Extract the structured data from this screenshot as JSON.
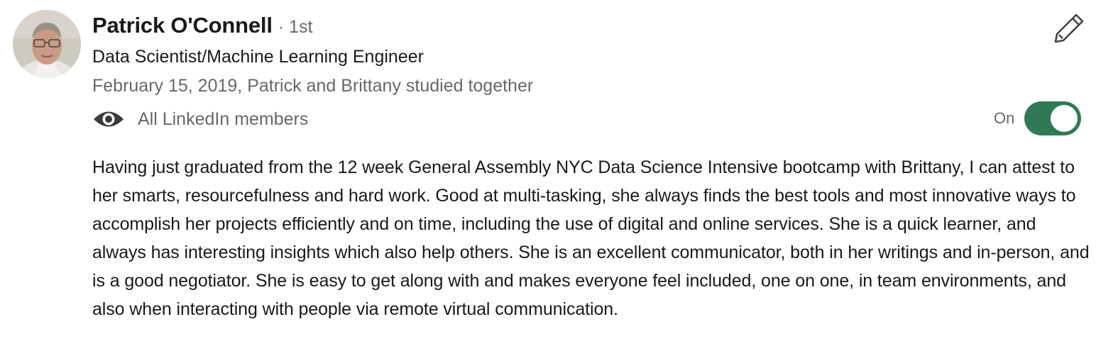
{
  "recommendation": {
    "author": {
      "name": "Patrick O'Connell",
      "degree": "· 1st",
      "headline": "Data Scientist/Machine Learning Engineer"
    },
    "relationship": "February 15, 2019, Patrick and Brittany studied together",
    "visibility": {
      "icon": "eye-icon",
      "label": "All LinkedIn members"
    },
    "toggle": {
      "label": "On",
      "state": "on",
      "color": "#2f7a54"
    },
    "edit_icon": "pencil-icon",
    "text": "Having just graduated from the 12 week General Assembly NYC Data Science Intensive bootcamp with Brittany, I can attest to her smarts, resourcefulness and hard work. Good at multi-tasking, she always finds the best tools and most innovative ways to accomplish her projects efficiently and on time, including the use of digital and online services. She is a quick learner, and always has interesting insights which also help others. She is an excellent communicator, both in her writings and in-person, and is a good negotiator. She is easy to get along with and makes everyone feel included, one on one, in team environments, and also when interacting with people via remote virtual communication."
  }
}
